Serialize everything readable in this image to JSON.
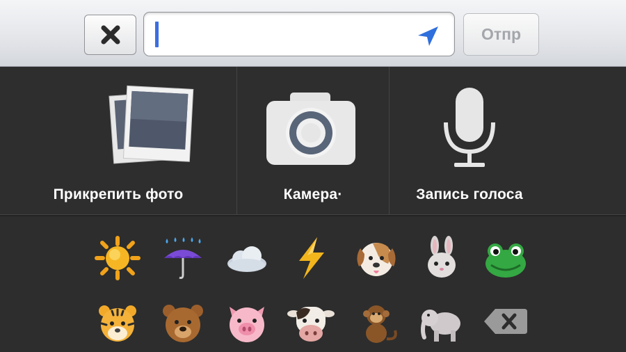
{
  "input_bar": {
    "close_icon": "close-x-icon",
    "input_value": "",
    "location_icon": "location-arrow-icon",
    "send_label": "Отпр"
  },
  "attachments": {
    "photo_label": "Прикрепить фото",
    "camera_label": "Камера·",
    "voice_label": "Запись голоса"
  },
  "emoji_rows": [
    [
      "sun",
      "umbrella-rain",
      "cloud",
      "lightning",
      "dog-face",
      "rabbit-face",
      "frog-face"
    ],
    [
      "tiger-face",
      "bear-face",
      "pig-face",
      "cow-face",
      "monkey",
      "elephant",
      "backspace"
    ]
  ],
  "colors": {
    "accent_caret": "#3b6fe0",
    "location_arrow": "#2f6fdd",
    "panel_bg": "#2e2e2e"
  }
}
